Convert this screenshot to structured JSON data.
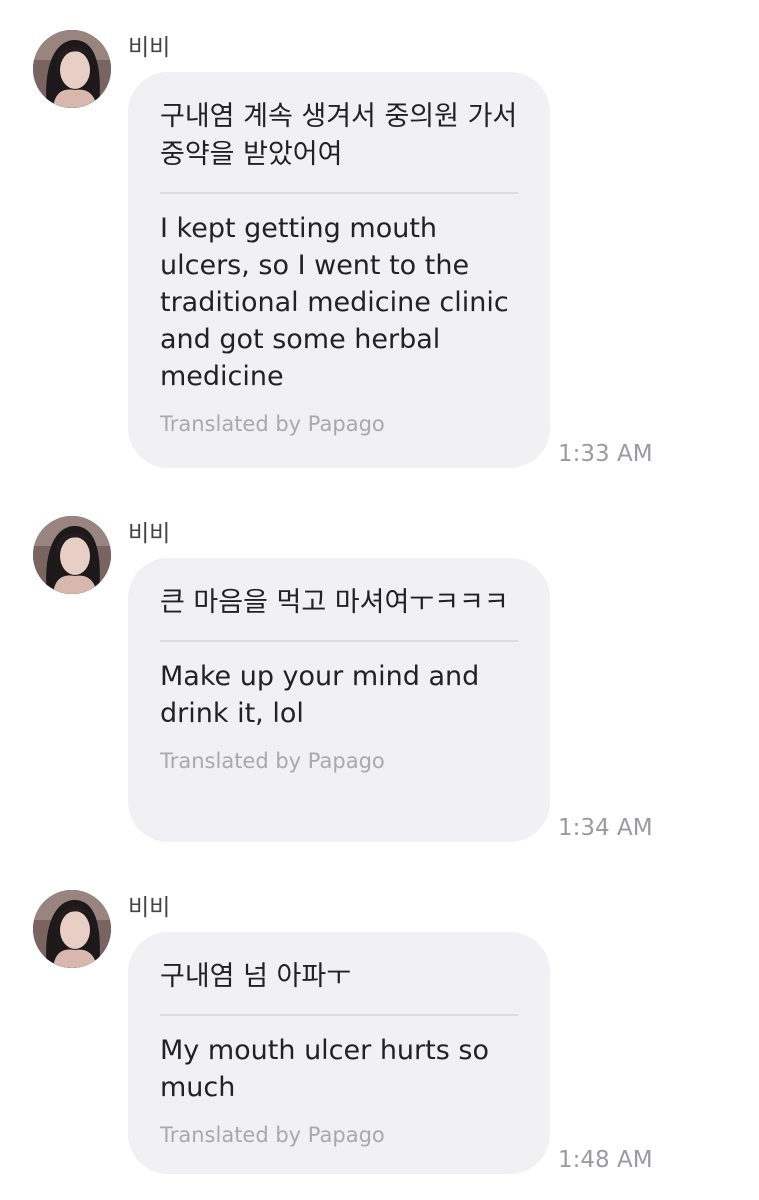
{
  "messages": [
    {
      "sender": "비비",
      "avatar_icon": "profile-photo-avatar",
      "original": "구내염 계속 생겨서 중의원 가서 중약을 받았어여",
      "translation": "I kept getting mouth ulcers, so I went to the traditional medicine clinic and got some herbal medicine",
      "credit": "Translated by Papago",
      "time": "1:33 AM"
    },
    {
      "sender": "비비",
      "avatar_icon": "profile-photo-avatar",
      "original": "큰 마음을 먹고 마셔여ㅜㅋㅋㅋ",
      "translation": "Make up your mind and drink it, lol",
      "credit": "Translated by Papago",
      "time": "1:34 AM"
    },
    {
      "sender": "비비",
      "avatar_icon": "profile-photo-avatar",
      "original": "구내염 넘 아파ㅜ",
      "translation": "My mouth ulcer hurts so much",
      "credit": "Translated by Papago",
      "time": "1:48 AM"
    }
  ],
  "colors": {
    "bubble": "#f1f1f4",
    "text": "#222222",
    "credit": "#a8a8ae",
    "time": "#9b9b9f",
    "divider": "#dcdce0"
  }
}
